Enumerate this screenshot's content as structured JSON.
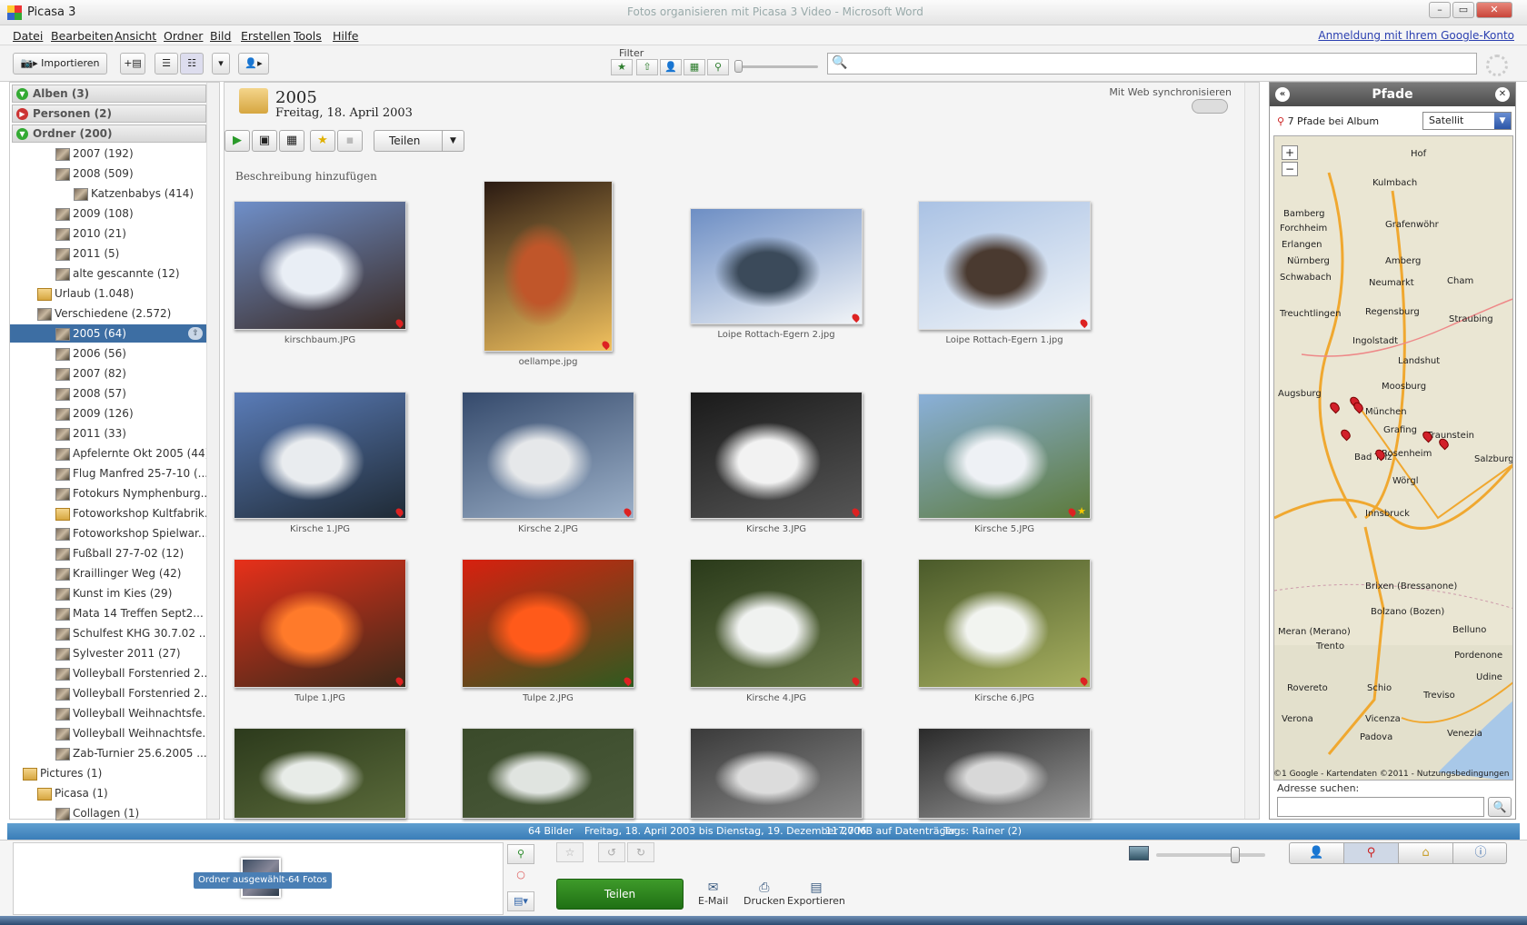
{
  "window": {
    "app_title": "Picasa 3",
    "window_title": "Fotos organisieren mit Picasa 3 Video - Microsoft Word"
  },
  "menu": {
    "items": [
      "Datei",
      "Bearbeiten",
      "Ansicht",
      "Ordner",
      "Bild",
      "Erstellen",
      "Tools",
      "Hilfe"
    ],
    "login": "Anmeldung mit Ihrem Google-Konto"
  },
  "toolbar": {
    "import_label": "Importieren",
    "filter_label": "Filter",
    "search_placeholder": ""
  },
  "sidebar": {
    "sections": [
      "Alben (3)",
      "Personen (2)",
      "Ordner (200)"
    ],
    "folders": [
      {
        "label": "2007 (192)",
        "level": 2
      },
      {
        "label": "2008 (509)",
        "level": 2,
        "expanded": true
      },
      {
        "label": "Katzenbabys (414)",
        "level": 3
      },
      {
        "label": "2009 (108)",
        "level": 2,
        "collapsed": true
      },
      {
        "label": "2010 (21)",
        "level": 2
      },
      {
        "label": "2011 (5)",
        "level": 2
      },
      {
        "label": "alte gescannte (12)",
        "level": 2
      },
      {
        "label": "Urlaub (1.048)",
        "level": 1,
        "collapsed": true,
        "folder": true
      },
      {
        "label": "Verschiedene (2.572)",
        "level": 1,
        "expanded": true
      },
      {
        "label": "2005 (64)",
        "level": 2,
        "selected": true
      },
      {
        "label": "2006 (56)",
        "level": 2
      },
      {
        "label": "2007 (82)",
        "level": 2
      },
      {
        "label": "2008 (57)",
        "level": 2
      },
      {
        "label": "2009 (126)",
        "level": 2
      },
      {
        "label": "2011 (33)",
        "level": 2,
        "collapsed": true
      },
      {
        "label": "Apfelernte Okt 2005 (44)",
        "level": 2
      },
      {
        "label": "Flug Manfred 25-7-10 (...",
        "level": 2
      },
      {
        "label": "Fotokurs Nymphenburg...",
        "level": 2
      },
      {
        "label": "Fotoworkshop Kultfabrik...",
        "level": 2,
        "collapsed": true,
        "folder": true
      },
      {
        "label": "Fotoworkshop Spielwar...",
        "level": 2
      },
      {
        "label": "Fußball 27-7-02 (12)",
        "level": 2
      },
      {
        "label": "Kraillinger Weg (42)",
        "level": 2
      },
      {
        "label": "Kunst im Kies (29)",
        "level": 2
      },
      {
        "label": "Mata 14 Treffen Sept2...",
        "level": 2
      },
      {
        "label": "Schulfest KHG 30.7.02 ...",
        "level": 2
      },
      {
        "label": "Sylvester 2011 (27)",
        "level": 2
      },
      {
        "label": "Volleyball Forstenried 2...",
        "level": 2
      },
      {
        "label": "Volleyball Forstenried 2...",
        "level": 2
      },
      {
        "label": "Volleyball Weihnachtsfe...",
        "level": 2
      },
      {
        "label": "Volleyball Weihnachtsfe...",
        "level": 2
      },
      {
        "label": "Zab-Turnier 25.6.2005 ...",
        "level": 2
      },
      {
        "label": "Pictures (1)",
        "level": 0,
        "expanded": true,
        "folder": true
      },
      {
        "label": "Picasa (1)",
        "level": 1,
        "expanded": true,
        "folder": true
      },
      {
        "label": "Collagen (1)",
        "level": 2
      }
    ]
  },
  "album": {
    "title": "2005",
    "date": "Freitag, 18. April 2003",
    "web_sync": "Mit Web synchronisieren",
    "share_label": "Teilen",
    "description_placeholder": "Beschreibung hinzufügen"
  },
  "photos": [
    {
      "caption": "kirschbaum.JPG",
      "colors": [
        "#6f8fc9",
        "#e9eef5",
        "#3a2a24"
      ]
    },
    {
      "caption": "oellampe.jpg",
      "colors": [
        "#2a1a12",
        "#c0562a",
        "#f1c15e"
      ]
    },
    {
      "caption": "Loipe Rottach-Egern 2.jpg",
      "colors": [
        "#6d8ec4",
        "#3b4a5a",
        "#f1f4f7"
      ]
    },
    {
      "caption": "Loipe Rottach-Egern 1.jpg",
      "colors": [
        "#aac2e4",
        "#4a3a30",
        "#f0f4f8"
      ]
    },
    {
      "caption": "Kirsche 1.JPG",
      "colors": [
        "#5a7cb8",
        "#e9ecef",
        "#1f2a35"
      ]
    },
    {
      "caption": "Kirsche 2.JPG",
      "colors": [
        "#354a6c",
        "#e6e8ea",
        "#9cb0c8"
      ]
    },
    {
      "caption": "Kirsche 3.JPG",
      "colors": [
        "#1a1a1a",
        "#f2f2f2",
        "#555555"
      ]
    },
    {
      "caption": "Kirsche 5.JPG",
      "colors": [
        "#8ab0d9",
        "#eef1f5",
        "#5c7a3a"
      ],
      "starred": true
    },
    {
      "caption": "Tulpe 1.JPG",
      "colors": [
        "#e8301a",
        "#ff7a2a",
        "#3a2a1a"
      ]
    },
    {
      "caption": "Tulpe 2.JPG",
      "colors": [
        "#d8200f",
        "#ff5a1a",
        "#2f5a20"
      ]
    },
    {
      "caption": "Kirsche 4.JPG",
      "colors": [
        "#2a3a1a",
        "#f0f2f0",
        "#6a7a4a"
      ]
    },
    {
      "caption": "Kirsche 6.JPG",
      "colors": [
        "#4a5a2a",
        "#f2f4f0",
        "#a8b060"
      ]
    },
    {
      "caption": "",
      "colors": [
        "#2c3a1c",
        "#e8ece8",
        "#5a6a3a"
      ]
    },
    {
      "caption": "",
      "colors": [
        "#3a4a2a",
        "#e0e4e0",
        "#4a5a3a"
      ]
    },
    {
      "caption": "",
      "colors": [
        "#3a3a3a",
        "#dcdcdc",
        "#8a8a8a"
      ]
    },
    {
      "caption": "",
      "colors": [
        "#2a2a2a",
        "#d8d8d8",
        "#9a9a9a"
      ]
    }
  ],
  "right_panel": {
    "title": "Pfade",
    "paths_label": "7 Pfade bei Album",
    "map_type": "Satellit",
    "cities": [
      "Hof",
      "Kulmbach",
      "Bamberg",
      "Grafenwöhr",
      "Erlangen",
      "Forchheim",
      "Nürnberg",
      "Schwabach",
      "Amberg",
      "Neumarkt",
      "Cham",
      "Regensburg",
      "Treuchtlingen",
      "Straubing",
      "Ingolstadt",
      "Landshut",
      "Augsburg",
      "Moosburg",
      "München",
      "Grafing",
      "Bad Tölz",
      "Rosenheim",
      "Traunstein",
      "Salzburg",
      "Innsbruck",
      "Wörgl",
      "Meran (Merano)",
      "Brixen (Bressanone)",
      "Bolzano (Bozen)",
      "Trento",
      "Belluno",
      "Pordenone",
      "Udine",
      "Rovereto",
      "Schio",
      "Treviso",
      "Verona",
      "Vicenza",
      "Padova",
      "Venezia"
    ],
    "map_footer": "©1 Google - Kartendaten ©2011 - Nutzungsbedingungen",
    "address_label": "Adresse suchen:"
  },
  "status": {
    "count": "64 Bilder",
    "range": "Freitag, 18. April 2003 bis Dienstag, 19. Dezember 2006",
    "size": "117,7 MB auf Datenträger",
    "tags": "Tags: Rainer (2)"
  },
  "tray": {
    "selection_label": "Ordner ausgewählt-64 Fotos",
    "share_label": "Teilen",
    "actions": [
      "E-Mail",
      "Drucken",
      "Exportieren"
    ]
  }
}
